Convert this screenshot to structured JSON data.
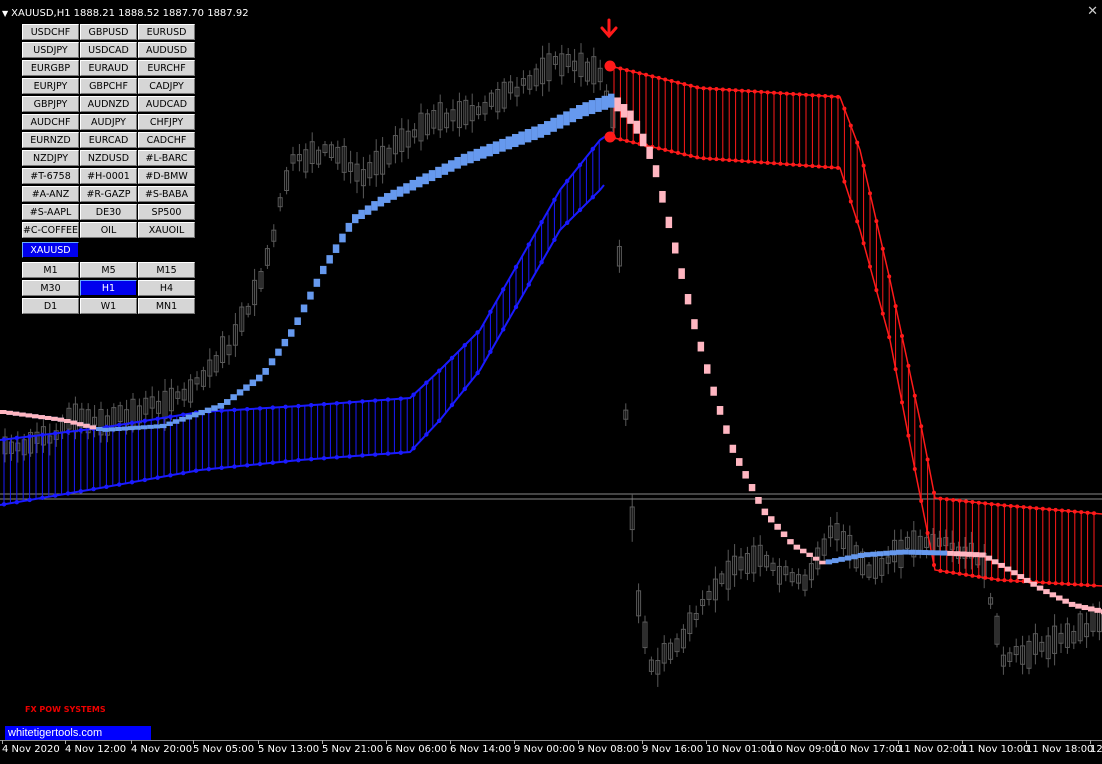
{
  "header": {
    "symbol_tf": "XAUUSD,H1",
    "ohlc": "1888.21 1888.52 1887.70 1887.92"
  },
  "symbol_buttons": [
    "USDCHF",
    "GBPUSD",
    "EURUSD",
    "USDJPY",
    "USDCAD",
    "AUDUSD",
    "EURGBP",
    "EURAUD",
    "EURCHF",
    "EURJPY",
    "GBPCHF",
    "CADJPY",
    "GBPJPY",
    "AUDNZD",
    "AUDCAD",
    "AUDCHF",
    "AUDJPY",
    "CHFJPY",
    "EURNZD",
    "EURCAD",
    "CADCHF",
    "NZDJPY",
    "NZDUSD",
    "#L-BARC",
    "#T-6758",
    "#H-0001",
    "#D-BMW",
    "#A-ANZ",
    "#R-GAZP",
    "#S-BABA",
    "#S-AAPL",
    "DE30",
    "SP500",
    "#C-COFFEE",
    "OIL",
    "XAUOIL"
  ],
  "active_symbol": "XAUUSD",
  "timeframe_buttons": [
    "M1",
    "M5",
    "M15",
    "M30",
    "H1",
    "H4",
    "D1",
    "W1",
    "MN1"
  ],
  "active_timeframe": "H1",
  "brand_label": "FX POW SYSTEMS",
  "website": "whitetigertools.com",
  "time_axis": [
    "4 Nov 2020",
    "4 Nov 12:00",
    "4 Nov 20:00",
    "5 Nov 05:00",
    "5 Nov 13:00",
    "5 Nov 21:00",
    "6 Nov 06:00",
    "6 Nov 14:00",
    "9 Nov 00:00",
    "9 Nov 08:00",
    "9 Nov 16:00",
    "10 Nov 01:00",
    "10 Nov 09:00",
    "10 Nov 17:00",
    "11 Nov 02:00",
    "11 Nov 10:00",
    "11 Nov 18:00",
    "12"
  ],
  "colors": {
    "bull_band": "#6699ee",
    "bear_band": "#ffb6c1",
    "blue_channel": "#1a1aff",
    "red_channel": "#ff1a1a",
    "candles": "#5a5a5a",
    "price_line": "#888888"
  },
  "icons": {
    "sell_signal": "arrow-down-icon",
    "close": "close-icon"
  }
}
